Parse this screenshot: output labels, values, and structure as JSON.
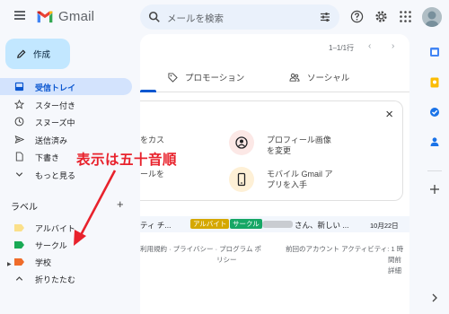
{
  "app": {
    "name": "Gmail"
  },
  "search": {
    "placeholder": "メールを検索"
  },
  "sidebar": {
    "compose_label": "作成",
    "items": [
      {
        "label": "受信トレイ",
        "icon": "inbox-icon",
        "active": true
      },
      {
        "label": "スター付き",
        "icon": "star-icon"
      },
      {
        "label": "スヌーズ中",
        "icon": "clock-icon"
      },
      {
        "label": "送信済み",
        "icon": "send-icon"
      },
      {
        "label": "下書き",
        "icon": "draft-icon"
      },
      {
        "label": "もっと見る",
        "icon": "chevron-down-icon"
      }
    ],
    "labels_title": "ラベル",
    "labels_add": "+",
    "labels": [
      {
        "label": "アルバイト",
        "color": "#fbe08a"
      },
      {
        "label": "サークル",
        "color": "#1aaa55"
      },
      {
        "label": "学校",
        "color": "#ef6c2a"
      }
    ],
    "collapse_label": "折りたたむ"
  },
  "pager": {
    "range": "1–1/1行"
  },
  "tabs": [
    {
      "label": "",
      "icon": "inbox-icon",
      "active": true
    },
    {
      "label": "プロモーション",
      "icon": "tag-icon"
    },
    {
      "label": "ソーシャル",
      "icon": "people-icon"
    }
  ],
  "setup_card": {
    "close": "×",
    "left_line1": "をカス",
    "left_line2": "ールを",
    "item1_line1": "プロフィール画像",
    "item1_line2": "を変更",
    "item2_line1": "モバイル Gmail ア",
    "item2_line2": "プリを入手"
  },
  "email_row": {
    "sender": "ティ チ...",
    "chip1": "アルバイト",
    "chip2": "サークル",
    "subject": "さん、新しい ...",
    "date": "10月22日"
  },
  "footer": {
    "links": "利用規約 · プライバシー · プログラム ポ",
    "links2": "リシー",
    "activity1": "前回のアカウント アクティビティ: 1 時",
    "activity2": "間前",
    "activity3": "詳細"
  },
  "annotation": {
    "text": "表示は五十音順"
  },
  "colors": {
    "accent": "#0b57d0",
    "compose_bg": "#c2e7ff",
    "annotation": "#e8222c"
  }
}
